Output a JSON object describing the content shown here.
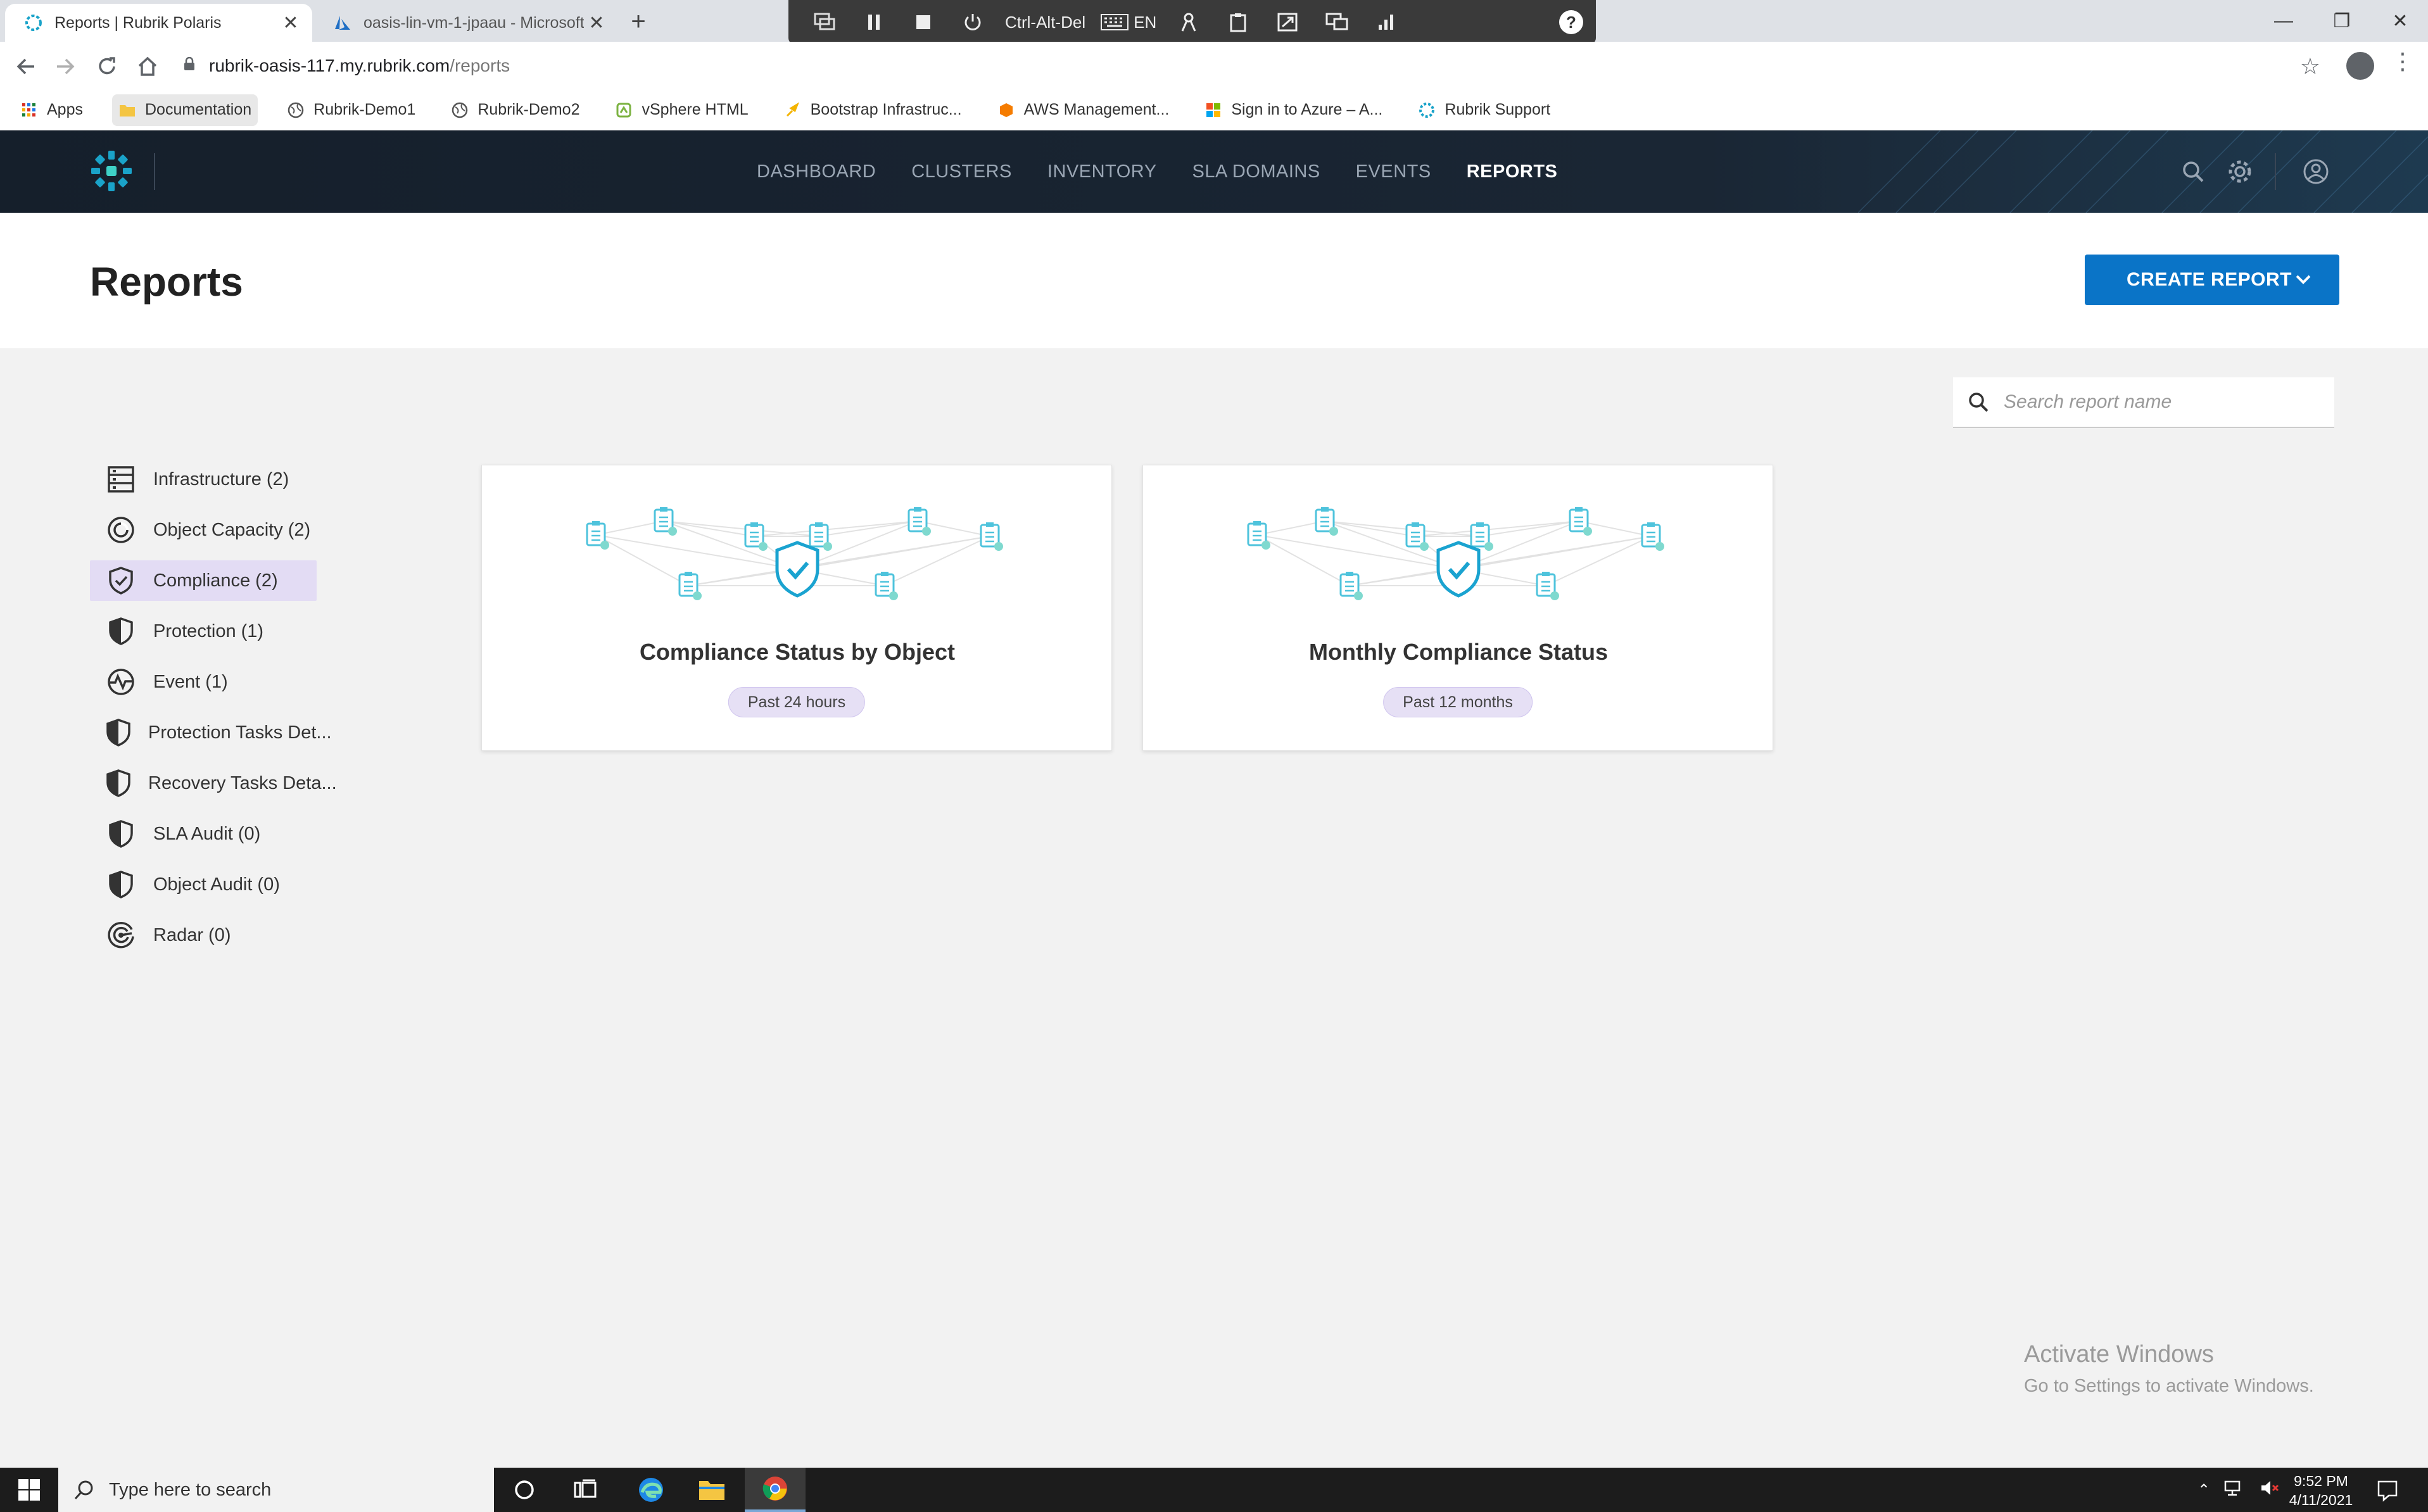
{
  "browser": {
    "tabs": [
      {
        "title": "Reports | Rubrik Polaris",
        "active": true
      },
      {
        "title": "oasis-lin-vm-1-jpaau - Microsoft",
        "active": false
      }
    ],
    "new_tab": "+",
    "url_host": "rubrik-oasis-117.my.rubrik.com",
    "url_path": "/reports",
    "bookmarks": [
      {
        "label": "Apps",
        "icon": "apps-grid-icon"
      },
      {
        "label": "Documentation",
        "icon": "folder-icon"
      },
      {
        "label": "Rubrik-Demo1",
        "icon": "globe-icon"
      },
      {
        "label": "Rubrik-Demo2",
        "icon": "globe-icon"
      },
      {
        "label": "vSphere HTML",
        "icon": "vsphere-icon"
      },
      {
        "label": "Bootstrap Infrastruc...",
        "icon": "bootstrap-icon"
      },
      {
        "label": "AWS Management...",
        "icon": "aws-icon"
      },
      {
        "label": "Sign in to Azure – A...",
        "icon": "microsoft-icon"
      },
      {
        "label": "Rubrik Support",
        "icon": "rubrik-icon"
      }
    ]
  },
  "remote_toolbar": {
    "ctrl_alt_del": "Ctrl-Alt-Del",
    "keyboard_lang": "EN",
    "help": "?"
  },
  "app": {
    "nav": [
      "DASHBOARD",
      "CLUSTERS",
      "INVENTORY",
      "SLA DOMAINS",
      "EVENTS",
      "REPORTS"
    ],
    "active_nav": "REPORTS",
    "brand_color": "#0a74c7"
  },
  "page": {
    "title": "Reports",
    "create_button": "CREATE REPORT",
    "search_placeholder": "Search report name"
  },
  "categories": [
    {
      "label": "Infrastructure (2)",
      "icon": "server-rack-icon",
      "selected": false
    },
    {
      "label": "Object Capacity (2)",
      "icon": "capacity-ring-icon",
      "selected": false
    },
    {
      "label": "Compliance (2)",
      "icon": "shield-check-icon",
      "selected": true
    },
    {
      "label": "Protection (1)",
      "icon": "shield-half-icon",
      "selected": false
    },
    {
      "label": "Event (1)",
      "icon": "pulse-icon",
      "selected": false
    },
    {
      "label": "Protection Tasks Det...",
      "icon": "shield-half-icon",
      "selected": false
    },
    {
      "label": "Recovery Tasks Deta...",
      "icon": "shield-half-icon",
      "selected": false
    },
    {
      "label": "SLA Audit (0)",
      "icon": "shield-half-icon",
      "selected": false
    },
    {
      "label": "Object Audit (0)",
      "icon": "shield-half-icon",
      "selected": false
    },
    {
      "label": "Radar (0)",
      "icon": "radar-icon",
      "selected": false
    }
  ],
  "reports": [
    {
      "title": "Compliance Status by Object",
      "period": "Past 24 hours"
    },
    {
      "title": "Monthly Compliance Status",
      "period": "Past 12 months"
    }
  ],
  "watermark": {
    "line1": "Activate Windows",
    "line2": "Go to Settings to activate Windows."
  },
  "taskbar": {
    "search_placeholder": "Type here to search",
    "time": "9:52 PM",
    "date": "4/11/2021"
  }
}
